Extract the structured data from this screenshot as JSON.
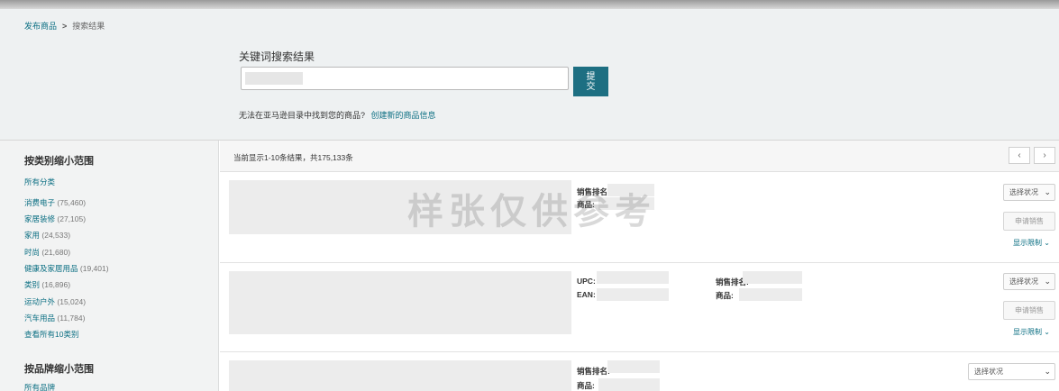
{
  "breadcrumb": {
    "parent": "发布商品",
    "separator": ">",
    "current": "搜索结果"
  },
  "search": {
    "title": "关键词搜索结果",
    "input_value": "",
    "submit_label": "提交"
  },
  "not_found": {
    "text": "无法在亚马逊目录中找到您的商品?",
    "link": "创建新的商品信息"
  },
  "sidebar": {
    "category_heading": "按类别缩小范围",
    "all_categories": "所有分类",
    "categories": [
      {
        "name": "消费电子",
        "count": "(75,460)"
      },
      {
        "name": "家居装修",
        "count": "(27,105)"
      },
      {
        "name": "家用",
        "count": "(24,533)"
      },
      {
        "name": "时尚",
        "count": "(21,680)"
      },
      {
        "name": "健康及家居用品",
        "count": "(19,401)"
      },
      {
        "name": "类别",
        "count": "(16,896)"
      },
      {
        "name": "运动户外",
        "count": "(15,024)"
      },
      {
        "name": "汽车用品",
        "count": "(11,784)"
      }
    ],
    "view_all": "查看所有10类别",
    "brand_heading": "按品牌缩小范围",
    "all_brands": "所有品牌"
  },
  "results": {
    "summary": "当前显示1-10条结果，共175,133条",
    "prev_icon": "‹",
    "next_icon": "›"
  },
  "rows": [
    {
      "sales_rank_label": "销售排名:",
      "product_label": "商品:",
      "select_label": "选择状况",
      "apply_label": "申请销售",
      "limit_label": "显示限制"
    },
    {
      "upc_label": "UPC:",
      "ean_label": "EAN:",
      "sales_rank_label": "销售排名:",
      "product_label": "商品:",
      "select_label": "选择状况",
      "apply_label": "申请销售",
      "limit_label": "显示限制"
    },
    {
      "sales_rank_label": "销售排名:",
      "product_label": "商品:",
      "select_label": "选择状况"
    }
  ],
  "watermark": "样张仅供参考",
  "colors": {
    "link": "#0a6e82",
    "submit_bg": "#1d6f82",
    "header_bg": "#eef1f2",
    "sidebar_bg": "#f2f3f3"
  }
}
